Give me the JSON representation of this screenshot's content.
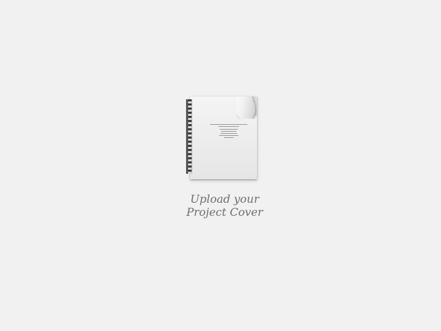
{
  "upload": {
    "caption_line1": "Upload your",
    "caption_line2": "Project Cover",
    "icon": "document-icon"
  },
  "colors": {
    "background": "#f1f1f1",
    "caption": "#6e6e6e",
    "binding": "#565656"
  }
}
